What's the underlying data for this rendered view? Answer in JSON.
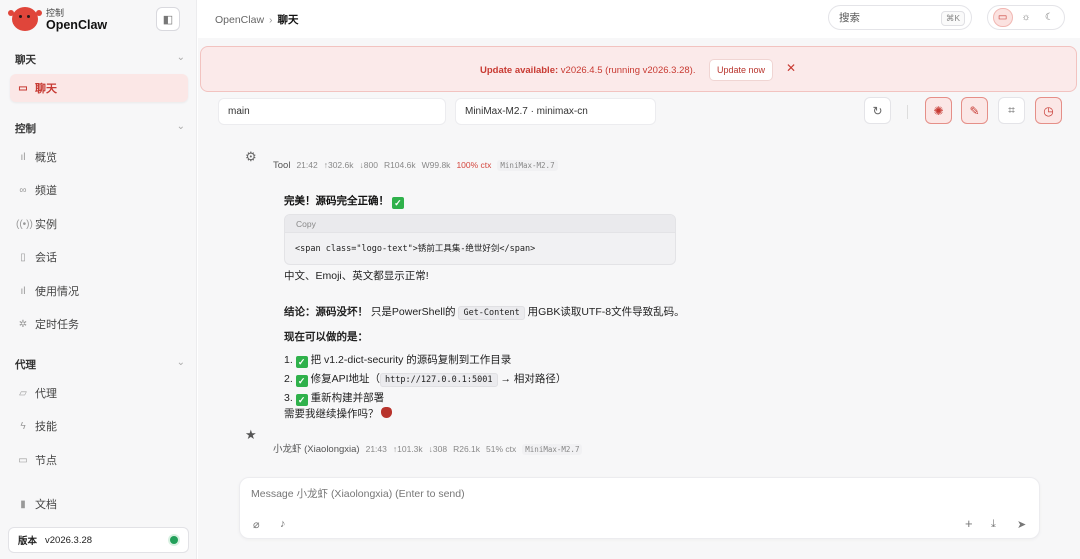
{
  "brand": {
    "subtitle": "控制",
    "name": "OpenClaw"
  },
  "sidebar": {
    "groups": [
      {
        "title": "聊天",
        "items": [
          {
            "label": "聊天",
            "icon": "chat-icon"
          }
        ]
      },
      {
        "title": "控制",
        "items": [
          {
            "label": "概览",
            "icon": "chart-icon"
          },
          {
            "label": "频道",
            "icon": "link-icon"
          },
          {
            "label": "实例",
            "icon": "radio-icon"
          },
          {
            "label": "会话",
            "icon": "document-icon"
          },
          {
            "label": "使用情况",
            "icon": "chart-icon"
          },
          {
            "label": "定时任务",
            "icon": "loader-icon"
          }
        ]
      },
      {
        "title": "代理",
        "items": [
          {
            "label": "代理",
            "icon": "folder-icon"
          },
          {
            "label": "技能",
            "icon": "bolt-icon"
          },
          {
            "label": "节点",
            "icon": "monitor-icon"
          }
        ]
      }
    ],
    "docs_label": "文档",
    "version_label": "版本",
    "version_value": "v2026.3.28",
    "status_color": "#22a05a"
  },
  "header": {
    "breadcrumb_root": "OpenClaw",
    "breadcrumb_sep": "›",
    "breadcrumb_current": "聊天",
    "search_placeholder": "搜索",
    "search_shortcut": "⌘K"
  },
  "banner": {
    "strong": "Update available:",
    "text": " v2026.4.5 (running v2026.3.28).",
    "button": "Update now",
    "close": "✕"
  },
  "controls": {
    "session": "main",
    "model": "MiniMax-M2.7 · minimax-cn"
  },
  "messages": {
    "tool": {
      "author": "Tool",
      "time": "21:42",
      "stats": [
        "↑302.6k",
        "↓800",
        "R104.6k",
        "W99.8k"
      ],
      "ctx": "100% ctx",
      "model": "MiniMax-M2.7"
    },
    "reply": {
      "title": "完美！源码完全正确！",
      "copy": "Copy",
      "code": "<span class=\"logo-text\">锈前工具集-绝世好剑</span>",
      "line1": "中文、Emoji、英文都显示正常!",
      "conclusion_bold": "结论：源码没坏！",
      "conclusion_pre": " 只是PowerShell的 ",
      "conclusion_code": "Get-Content",
      "conclusion_post": " 用GBK读取UTF-8文件导致乱码。",
      "next_heading": "现在可以做的是：",
      "step1": "把 v1.2-dict-security 的源码复制到工作目录",
      "step2_pre": "修复API地址（",
      "step2_code": "http://127.0.0.1:5001",
      "step2_post": "→ 相对路径）",
      "step3": "重新构建并部署",
      "question": "需要我继续操作吗？"
    },
    "assistant_meta": {
      "author": "小龙虾 (Xiaolongxia)",
      "time": "21:43",
      "stats": [
        "↑101.3k",
        "↓308",
        "R26.1k"
      ],
      "ctx": "51% ctx",
      "model": "MiniMax-M2.7"
    }
  },
  "composer": {
    "placeholder": "Message 小龙虾 (Xiaolongxia) (Enter to send)"
  },
  "colors": {
    "accent": "#c73a33",
    "banner_bg": "#fbeaea",
    "success": "#2fb14b"
  }
}
